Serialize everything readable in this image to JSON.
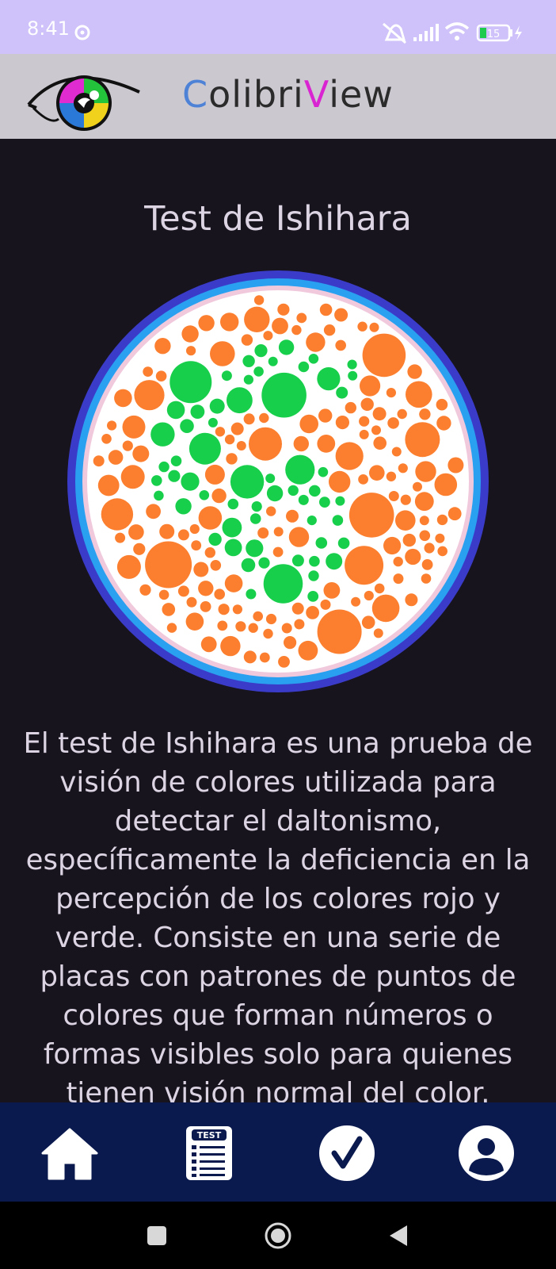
{
  "status_bar": {
    "time": "8:41",
    "battery": "15"
  },
  "header": {
    "app_title_parts": [
      "C",
      "olibri",
      "V",
      "iew"
    ]
  },
  "main": {
    "title": "Test de Ishihara",
    "description": "El test de Ishihara es una prueba de visión de colores utilizada para detectar el daltonismo, específicamente la deficiencia en la percepción de los colores rojo y verde. Consiste en una serie de placas con patrones de puntos de colores que forman números o formas visibles solo para quienes tienen visión normal del color."
  },
  "colors": {
    "status_bar": "#cfc1f9",
    "header": "#ccc8d0",
    "background": "#17141d",
    "bottom_nav": "#0b1a4e",
    "plate_orange": "#fb7f2f",
    "plate_green": "#18cf4c",
    "ring_outer": "#3b3bc9",
    "ring_inner": "#2aa0f0"
  },
  "bottom_nav": {
    "items": [
      {
        "icon": "home-icon"
      },
      {
        "icon": "test-list-icon",
        "badge": "TEST"
      },
      {
        "icon": "check-icon"
      },
      {
        "icon": "user-icon"
      }
    ]
  },
  "system_nav": {
    "items": [
      {
        "icon": "recents-icon"
      },
      {
        "icon": "home-circle-icon"
      },
      {
        "icon": "back-icon"
      }
    ]
  }
}
